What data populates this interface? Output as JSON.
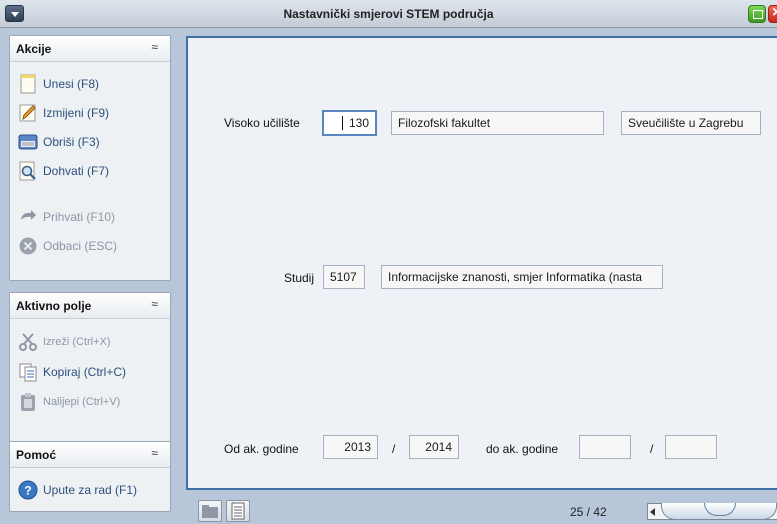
{
  "window": {
    "title": "Nastavnički smjerovi STEM područja"
  },
  "sidebar": {
    "actions": {
      "title": "Akcije",
      "items": [
        {
          "label": "Unesi (F8)",
          "icon": "new-document-icon",
          "enabled": true
        },
        {
          "label": "Izmijeni (F9)",
          "icon": "edit-pencil-icon",
          "enabled": true
        },
        {
          "label": "Obriši (F3)",
          "icon": "delete-icon",
          "enabled": true
        },
        {
          "label": "Dohvati (F7)",
          "icon": "search-magnifier-icon",
          "enabled": true
        },
        {
          "label": "Prihvati (F10)",
          "icon": "accept-arrow-icon",
          "enabled": false
        },
        {
          "label": "Odbaci (ESC)",
          "icon": "cancel-icon",
          "enabled": false
        }
      ]
    },
    "active_field": {
      "title": "Aktivno polje",
      "items": [
        {
          "label": "Izreži (Ctrl+X)",
          "icon": "scissors-icon",
          "enabled": false
        },
        {
          "label": "Kopiraj (Ctrl+C)",
          "icon": "copy-icon",
          "enabled": true
        },
        {
          "label": "Nalijepi (Ctrl+V)",
          "icon": "paste-icon",
          "enabled": false
        }
      ]
    },
    "help": {
      "title": "Pomoć",
      "items": [
        {
          "label": "Upute za rad (F1)",
          "icon": "help-icon",
          "enabled": true
        }
      ]
    }
  },
  "form": {
    "visoko_uciliste": {
      "label": "Visoko učilište",
      "code": "130",
      "name": "Filozofski fakultet",
      "university": "Sveučilište u Zagrebu"
    },
    "studij": {
      "label": "Studij",
      "code": "5107",
      "name": "Informacijske znanosti, smjer Informatika (nasta"
    },
    "od_ak_godine": {
      "label": "Od ak. godine",
      "from": "2013",
      "separator": "/",
      "to": "2014"
    },
    "do_ak_godine": {
      "label": "do ak. godine",
      "from": "",
      "separator": "/",
      "to": ""
    }
  },
  "statusbar": {
    "record": "25 / 42"
  },
  "colors": {
    "accent": "#3f6fa8",
    "link_text": "#2d4f7c",
    "disabled_text": "#8a96a6"
  }
}
